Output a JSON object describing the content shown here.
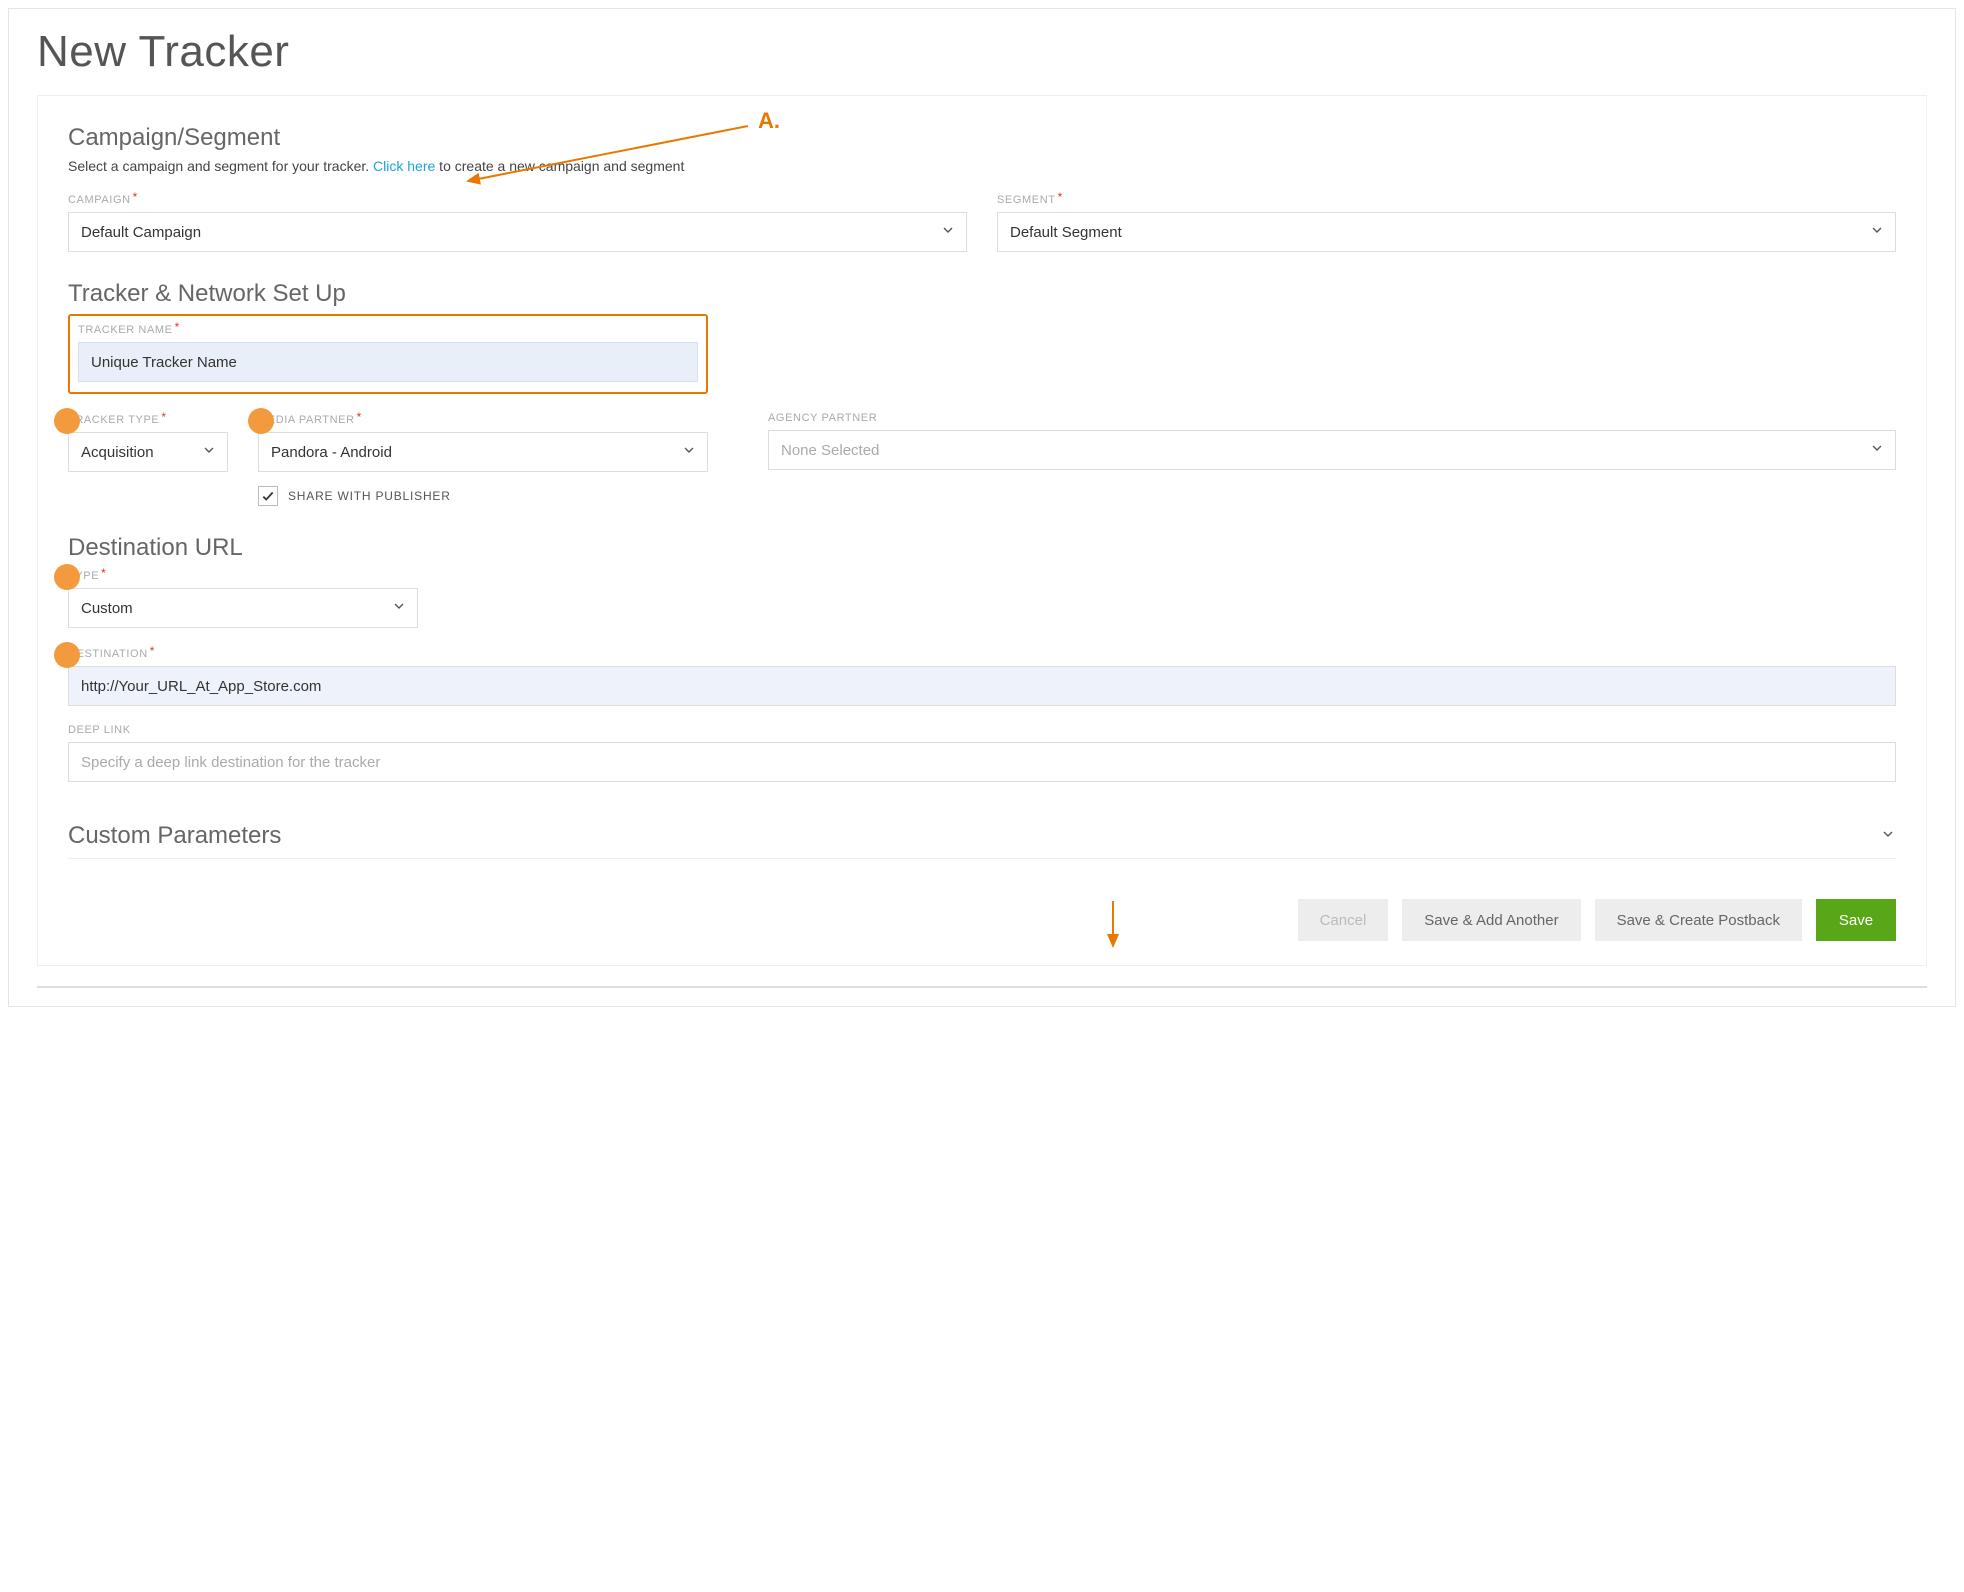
{
  "page": {
    "title": "New Tracker"
  },
  "annotation": {
    "a_label": "A."
  },
  "campaign_segment": {
    "title": "Campaign/Segment",
    "sub_pre": "Select a campaign and segment for your tracker. ",
    "link": "Click here",
    "sub_post": " to create a new campaign and segment",
    "campaign_label": "CAMPAIGN",
    "campaign_value": "Default Campaign",
    "segment_label": "SEGMENT",
    "segment_value": "Default Segment"
  },
  "tracker_setup": {
    "title": "Tracker & Network Set Up",
    "name_label": "TRACKER NAME",
    "name_value": "Unique Tracker Name",
    "type_label": "TRACKER TYPE",
    "type_value": "Acquisition",
    "media_label": "MEDIA PARTNER",
    "media_value": "Pandora - Android",
    "agency_label": "AGENCY PARTNER",
    "agency_value": "None Selected",
    "share_label": "SHARE WITH PUBLISHER"
  },
  "destination": {
    "title": "Destination URL",
    "type_label": "TYPE",
    "type_value": "Custom",
    "dest_label": "DESTINATION",
    "dest_value": "http://Your_URL_At_App_Store.com",
    "deep_label": "DEEP LINK",
    "deep_placeholder": "Specify a deep link destination for the tracker"
  },
  "custom_params": {
    "title": "Custom Parameters"
  },
  "actions": {
    "cancel": "Cancel",
    "save_add": "Save & Add Another",
    "save_postback": "Save & Create Postback",
    "save": "Save"
  }
}
